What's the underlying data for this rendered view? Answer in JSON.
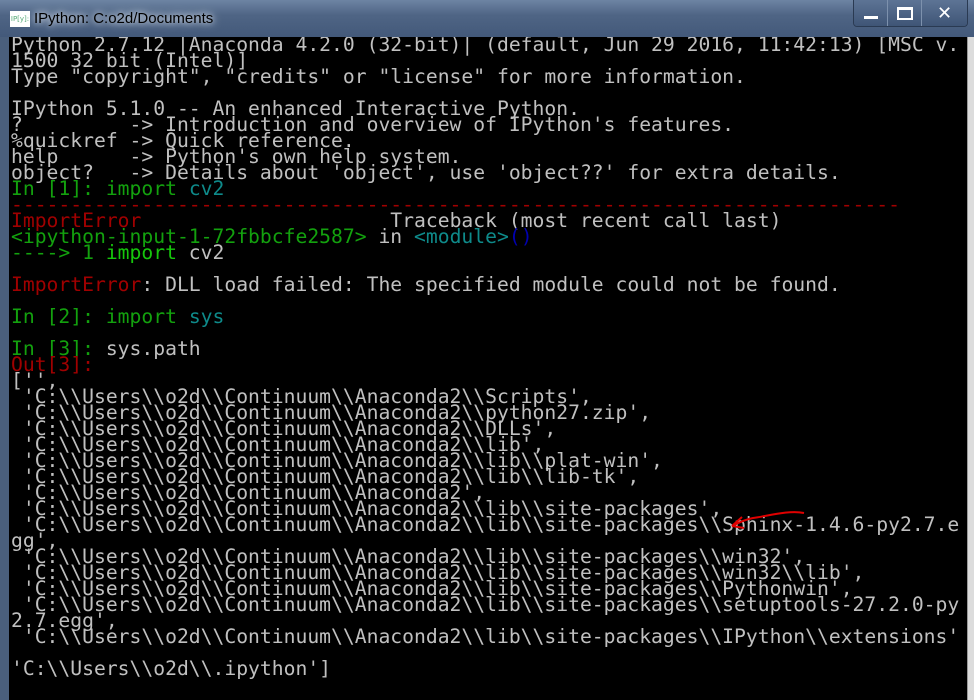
{
  "window": {
    "title": "IPython: C:o2d/Documents",
    "app_icon": "ipython-icon",
    "controls": {
      "minimize": "minimize-icon",
      "maximize": "maximize-icon",
      "close": "close-icon"
    }
  },
  "console": {
    "banner": [
      "Python 2.7.12 |Anaconda 4.2.0 (32-bit)| (default, Jun 29 2016, 11:42:13) [MSC v.",
      "1500 32 bit (Intel)]",
      "Type \"copyright\", \"credits\" or \"license\" for more information.",
      "",
      "IPython 5.1.0 -- An enhanced Interactive Python.",
      "?         -> Introduction and overview of IPython's features.",
      "%quickref -> Quick reference.",
      "help      -> Python's own help system.",
      "object?   -> Details about 'object', use 'object??' for extra details."
    ],
    "in1": {
      "prompt": "In [1]: ",
      "keyword": "import",
      "module": "cv2"
    },
    "separator": "---------------------------------------------------------------------------",
    "traceback": {
      "error_name": "ImportError",
      "header_right": "                     Traceback (most recent call last)",
      "input_ref": "<ipython-input-1-72fbbcfe2587>",
      "in_word": " in ",
      "module_ref": "<module>",
      "parens": "()",
      "arrow": "----> 1 ",
      "keyword": "import",
      "code": " cv2",
      "message": ": DLL load failed: The specified module could not be found."
    },
    "in2": {
      "prompt": "In [2]: ",
      "keyword": "import",
      "module": "sys"
    },
    "in3": {
      "prompt": "In [3]: ",
      "code": "sys.path"
    },
    "out3": {
      "prompt": "Out[3]:"
    },
    "output_lines": [
      "['',",
      " 'C:\\\\Users\\\\o2d\\\\Continuum\\\\Anaconda2\\\\Scripts',",
      " 'C:\\\\Users\\\\o2d\\\\Continuum\\\\Anaconda2\\\\python27.zip',",
      " 'C:\\\\Users\\\\o2d\\\\Continuum\\\\Anaconda2\\\\DLLs',",
      " 'C:\\\\Users\\\\o2d\\\\Continuum\\\\Anaconda2\\\\lib',",
      " 'C:\\\\Users\\\\o2d\\\\Continuum\\\\Anaconda2\\\\lib\\\\plat-win',",
      " 'C:\\\\Users\\\\o2d\\\\Continuum\\\\Anaconda2\\\\lib\\\\lib-tk',",
      " 'C:\\\\Users\\\\o2d\\\\Continuum\\\\Anaconda2',",
      " 'C:\\\\Users\\\\o2d\\\\Continuum\\\\Anaconda2\\\\lib\\\\site-packages',",
      " 'C:\\\\Users\\\\o2d\\\\Continuum\\\\Anaconda2\\\\lib\\\\site-packages\\\\Sphinx-1.4.6-py2.7.e",
      "gg',",
      " 'C:\\\\Users\\\\o2d\\\\Continuum\\\\Anaconda2\\\\lib\\\\site-packages\\\\win32',",
      " 'C:\\\\Users\\\\o2d\\\\Continuum\\\\Anaconda2\\\\lib\\\\site-packages\\\\win32\\\\lib',",
      " 'C:\\\\Users\\\\o2d\\\\Continuum\\\\Anaconda2\\\\lib\\\\site-packages\\\\Pythonwin',",
      " 'C:\\\\Users\\\\o2d\\\\Continuum\\\\Anaconda2\\\\lib\\\\site-packages\\\\setuptools-27.2.0-py",
      "2.7.egg',",
      " 'C:\\\\Users\\\\o2d\\\\Continuum\\\\Anaconda2\\\\lib\\\\site-packages\\\\IPython\\\\extensions'",
      "",
      "'C:\\\\Users\\\\o2d\\\\.ipython']"
    ],
    "annotation": {
      "type": "red-arrow",
      "color": "#e00000",
      "points_to": "site-packages line"
    }
  },
  "colors": {
    "prompt_in": "#13a10e",
    "prompt_out": "#a00000",
    "error": "#a00000",
    "module": "#0e8a8a",
    "keyword_bright": "#16c60c",
    "text": "#c0c0c0"
  }
}
